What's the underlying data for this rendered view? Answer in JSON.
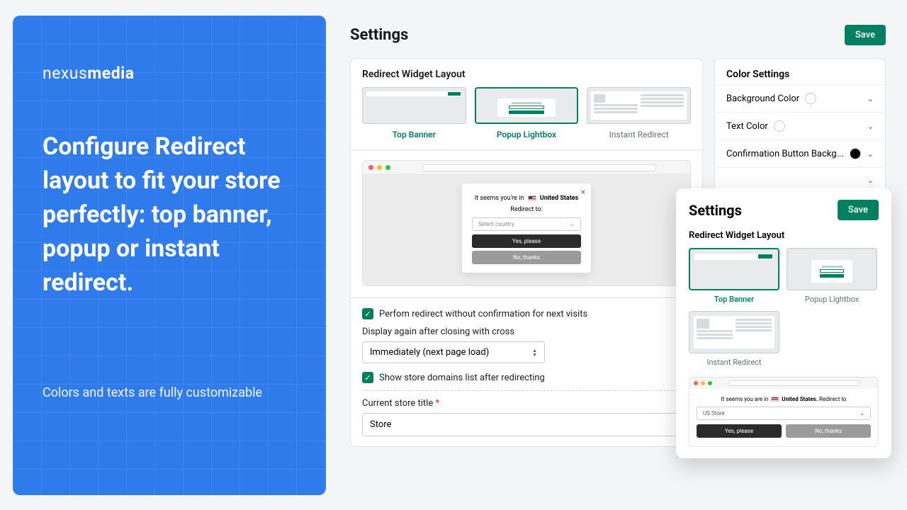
{
  "promo": {
    "logo_light": "nexus",
    "logo_bold": "media",
    "headline": "Configure Redirect layout to fit your store perfectly: top banner, popup or instant redirect.",
    "sub": "Colors and texts are fully customizable"
  },
  "page": {
    "title": "Settings",
    "save": "Save"
  },
  "layout_section": {
    "heading": "Redirect Widget Layout",
    "options": [
      {
        "label": "Top Banner"
      },
      {
        "label": "Popup Lightbox"
      },
      {
        "label": "Instant Redirect"
      }
    ]
  },
  "preview": {
    "seems_prefix": "It seems you're in",
    "country": "United States",
    "redirect_to": "Redirect to:",
    "select_placeholder": "Select country",
    "yes": "Yes, please",
    "no": "No, thanks"
  },
  "form": {
    "check1": "Perfom redirect without confirmation for next visits",
    "display_again": "Display again after closing with cross",
    "select_value": "Immediately (next page load)",
    "check2": "Show store domains list after redirecting",
    "store_title_label": "Current store title",
    "store_title_value": "Store"
  },
  "color_settings": {
    "heading": "Color Settings",
    "rows": [
      {
        "label": "Background Color",
        "swatch": "white"
      },
      {
        "label": "Text Color",
        "swatch": "white"
      },
      {
        "label": "Confirmation Button Backg...",
        "swatch": "black"
      },
      {
        "label": "",
        "swatch": null
      },
      {
        "label": "",
        "swatch": null
      },
      {
        "label": "",
        "swatch": null
      }
    ]
  },
  "overlay": {
    "title": "Settings",
    "save": "Save",
    "section": "Redirect Widget Layout",
    "options": [
      {
        "label": "Top Banner"
      },
      {
        "label": "Popup Lightbox"
      },
      {
        "label": "Instant Redirect"
      }
    ],
    "preview": {
      "text": "It seems you are in",
      "country": "United States.",
      "tail": "Redirect to",
      "select": "US Store",
      "yes": "Yes, please",
      "no": "No, thanks"
    }
  }
}
